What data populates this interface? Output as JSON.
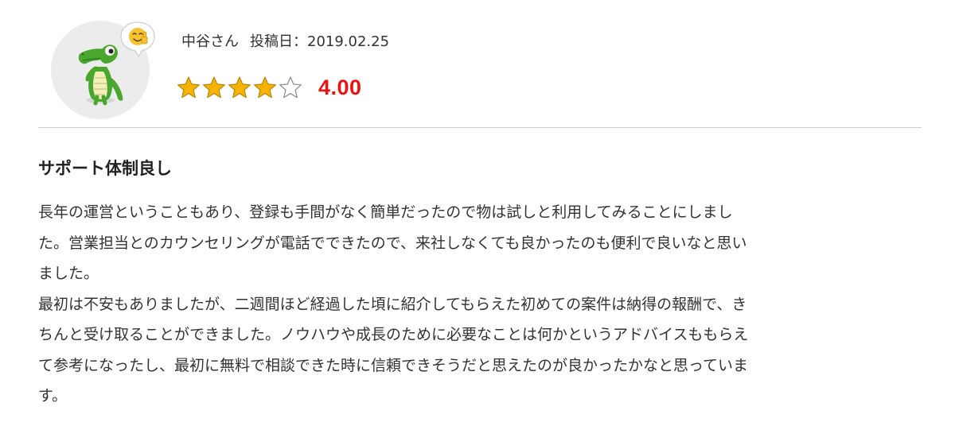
{
  "review": {
    "reviewer_name": "中谷さん",
    "posted_label": "投稿日：2019.02.25",
    "rating": {
      "value": 4,
      "max": 5,
      "display": "4.00",
      "color": "#ee1111",
      "star_fill_color": "#f4b400"
    },
    "title": "サポート体制良し",
    "paragraphs": [
      "長年の運営ということもあり、登録も手間がなく簡単だったので物は試しと利用してみることにしまし\nた。営業担当とのカウンセリングが電話でできたので、来社しなくても良かったのも便利で良いなと思い\nました。",
      "最初は不安もありましたが、二週間ほど経過した頃に紹介してもらえた初めての案件は納得の報酬で、き\nちんと受け取ることができました。ノウハウや成長のために必要なことは何かというアドバイスももらえ\nて参考になったし、最初に無料で相談できた時に信頼できそうだと思えたのが良かったかなと思っていま\nす。"
    ]
  },
  "icons": {
    "avatar": "crocodile-mascot-icon",
    "bubble": "thumbs-up-emoji-icon",
    "star": "star-icon"
  }
}
